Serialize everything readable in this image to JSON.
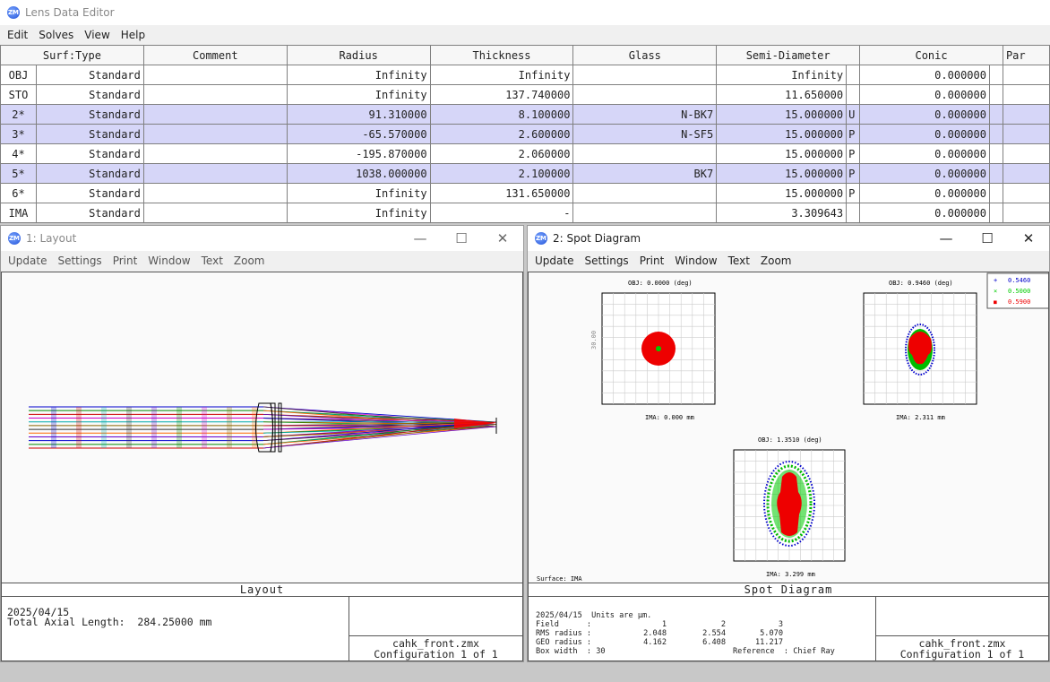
{
  "lde": {
    "title": "Lens Data Editor",
    "menu": [
      "Edit",
      "Solves",
      "View",
      "Help"
    ],
    "headers": [
      "Surf:Type",
      "Comment",
      "Radius",
      "Thickness",
      "Glass",
      "Semi-Diameter",
      "Conic",
      "Par"
    ],
    "rows": [
      {
        "surf": "OBJ",
        "type": "Standard",
        "comment": "",
        "radius": "Infinity",
        "thickness": "Infinity",
        "glass": "",
        "semi": "Infinity",
        "solve": "",
        "conic": "0.000000",
        "selected": false
      },
      {
        "surf": "STO",
        "type": "Standard",
        "comment": "",
        "radius": "Infinity",
        "thickness": "137.740000",
        "glass": "",
        "semi": "11.650000",
        "solve": "",
        "conic": "0.000000",
        "selected": false
      },
      {
        "surf": "2*",
        "type": "Standard",
        "comment": "",
        "radius": "91.310000",
        "thickness": "8.100000",
        "glass": "N-BK7",
        "semi": "15.000000",
        "solve": "U",
        "conic": "0.000000",
        "selected": true
      },
      {
        "surf": "3*",
        "type": "Standard",
        "comment": "",
        "radius": "-65.570000",
        "thickness": "2.600000",
        "glass": "N-SF5",
        "semi": "15.000000",
        "solve": "P",
        "conic": "0.000000",
        "selected": true
      },
      {
        "surf": "4*",
        "type": "Standard",
        "comment": "",
        "radius": "-195.870000",
        "thickness": "2.060000",
        "glass": "",
        "semi": "15.000000",
        "solve": "P",
        "conic": "0.000000",
        "selected": false
      },
      {
        "surf": "5*",
        "type": "Standard",
        "comment": "",
        "radius": "1038.000000",
        "thickness": "2.100000",
        "glass": "BK7",
        "semi": "15.000000",
        "solve": "P",
        "conic": "0.000000",
        "selected": true
      },
      {
        "surf": "6*",
        "type": "Standard",
        "comment": "",
        "radius": "Infinity",
        "thickness": "131.650000",
        "glass": "",
        "semi": "15.000000",
        "solve": "P",
        "conic": "0.000000",
        "selected": false
      },
      {
        "surf": "IMA",
        "type": "Standard",
        "comment": "",
        "radius": "Infinity",
        "thickness": "-",
        "glass": "",
        "semi": "3.309643",
        "solve": "",
        "conic": "0.000000",
        "selected": false
      }
    ]
  },
  "layout": {
    "title": "1: Layout",
    "menu": [
      "Update",
      "Settings",
      "Print",
      "Window",
      "Text",
      "Zoom"
    ],
    "label": "Layout",
    "date": "2025/04/15",
    "axial": "Total Axial Length:  284.25000 mm",
    "file": "cahk_front.zmx",
    "config": "Configuration 1 of 1"
  },
  "spot": {
    "title": "2: Spot Diagram",
    "menu": [
      "Update",
      "Settings",
      "Print",
      "Window",
      "Text",
      "Zoom"
    ],
    "label": "Spot Diagram",
    "surface": "Surface: IMA",
    "scale_label": "30.00",
    "fields": [
      {
        "obj": "OBJ: 0.0000 (deg)",
        "ima": "IMA: 0.000 mm"
      },
      {
        "obj": "OBJ: 0.9460 (deg)",
        "ima": "IMA: 2.311 mm"
      },
      {
        "obj": "OBJ: 1.3510 (deg)",
        "ima": "IMA: 3.299 mm"
      }
    ],
    "legend": [
      {
        "label": "0.5460",
        "color": "#0000cc",
        "sym": "+"
      },
      {
        "label": "0.5000",
        "color": "#00cc00",
        "sym": "×"
      },
      {
        "label": "0.5900",
        "color": "#ee0000",
        "sym": "■"
      }
    ],
    "info": {
      "line1": "2025/04/15  Units are µm.",
      "field_label": "Field      :",
      "field_vals": [
        "1",
        "2",
        "3"
      ],
      "rms_label": "RMS radius :",
      "rms_vals": [
        "2.048",
        "2.554",
        "5.070"
      ],
      "geo_label": "GEO radius :",
      "geo_vals": [
        "4.162",
        "6.408",
        "11.217"
      ],
      "box": "Box width  : 30",
      "ref": "Reference  : Chief Ray"
    },
    "file": "cahk_front.zmx",
    "config": "Configuration 1 of 1"
  }
}
